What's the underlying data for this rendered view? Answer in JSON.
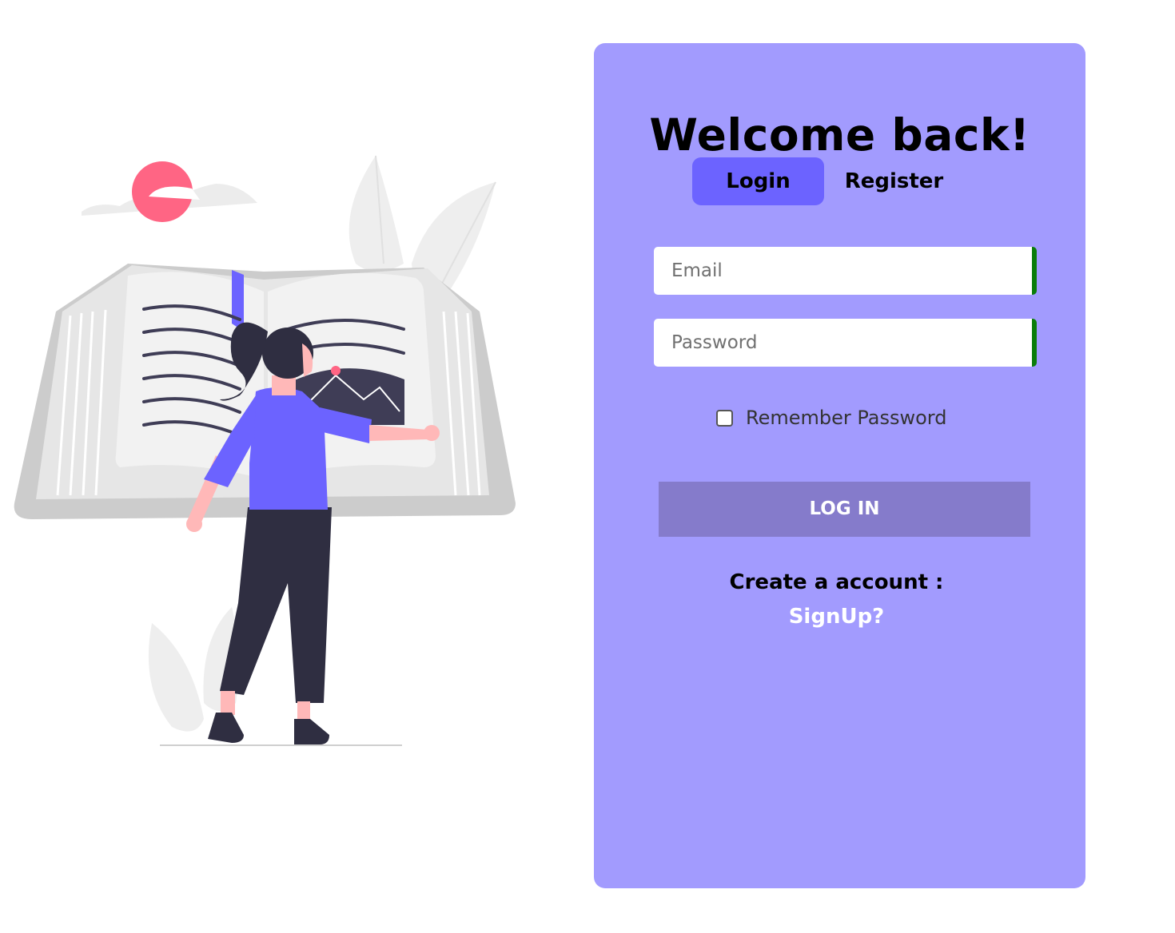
{
  "card": {
    "title": "Welcome back!",
    "tabs": [
      {
        "label": "Login",
        "active": true
      },
      {
        "label": "Register",
        "active": false
      }
    ],
    "email": {
      "placeholder": "Email",
      "value": ""
    },
    "password": {
      "placeholder": "Password",
      "value": ""
    },
    "remember": {
      "label": "Remember Password",
      "checked": false
    },
    "login_button": "LOG IN",
    "create_account_text": "Create a account :",
    "signup_link": "SignUp?"
  },
  "colors": {
    "card_background": "#a29bfe",
    "active_tab": "#6c63ff",
    "login_button": "#857bcb",
    "field_accent": "#0a7d0a",
    "sun": "#ff6584"
  },
  "illustration": {
    "icon": "woman-reading-open-book-illustration"
  }
}
